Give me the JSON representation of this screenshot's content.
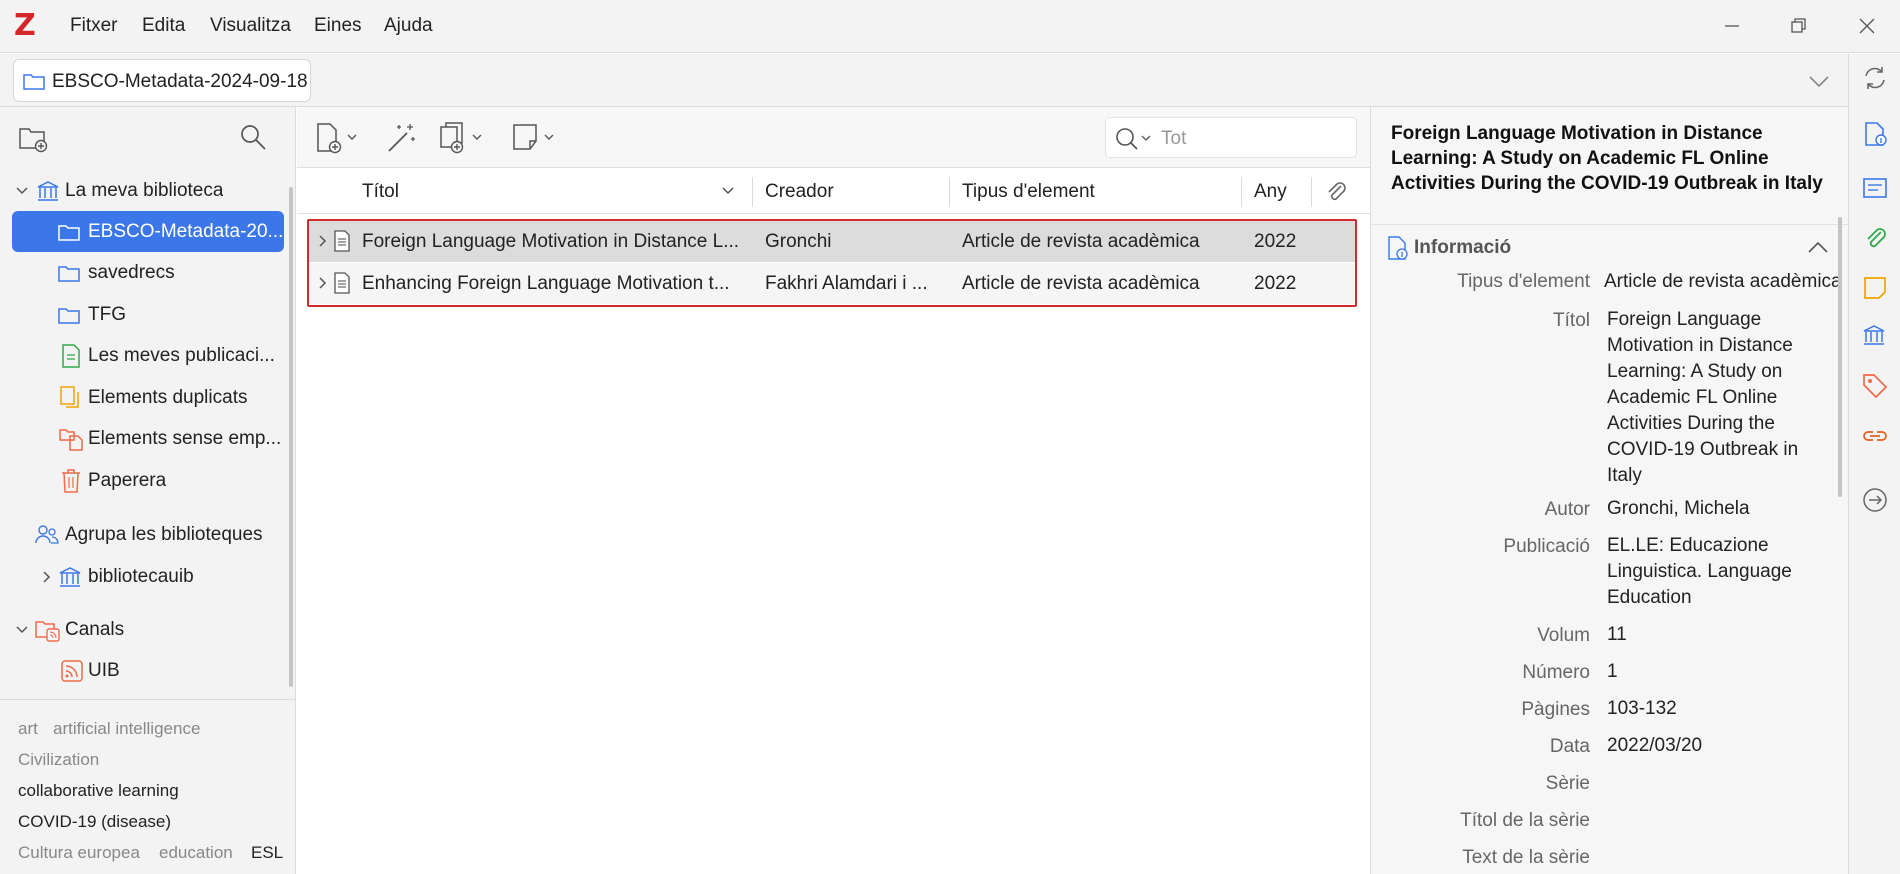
{
  "app": {
    "logo": "Z"
  },
  "menu": [
    "Fitxer",
    "Edita",
    "Visualitza",
    "Eines",
    "Ajuda"
  ],
  "tab": {
    "label": "EBSCO-Metadata-2024-09-18"
  },
  "library": {
    "items": [
      {
        "label": "La meva biblioteca"
      },
      {
        "label": "EBSCO-Metadata-20..."
      },
      {
        "label": "savedrecs"
      },
      {
        "label": "TFG"
      },
      {
        "label": "Les meves publicaci..."
      },
      {
        "label": "Elements duplicats"
      },
      {
        "label": "Elements sense emp..."
      },
      {
        "label": "Paperera"
      },
      {
        "label": "Agrupa les biblioteques"
      },
      {
        "label": "bibliotecauib"
      },
      {
        "label": "Canals"
      },
      {
        "label": "UIB"
      }
    ]
  },
  "tags": [
    "art",
    "artificial intelligence",
    "Civilization",
    "collaborative learning",
    "COVID-19 (disease)",
    "Cultura europea",
    "education",
    "ESL"
  ],
  "search": {
    "placeholder": "Tot"
  },
  "columns": {
    "title": "Títol",
    "creator": "Creador",
    "type": "Tipus d'element",
    "year": "Any"
  },
  "rows": [
    {
      "title": "Foreign Language Motivation in Distance L...",
      "creator": "Gronchi",
      "type": "Article de revista acadèmica",
      "year": "2022"
    },
    {
      "title": "Enhancing Foreign Language Motivation t...",
      "creator": "Fakhri Alamdari i ...",
      "type": "Article de revista acadèmica",
      "year": "2022"
    }
  ],
  "item": {
    "title": "Foreign Language Motivation in Distance Learning: A Study on Academic FL Online Activities During the COVID-19 Outbreak in Italy",
    "section": "Informació",
    "fields": [
      {
        "label": "Tipus d'element",
        "value": "Article de revista acadèmica"
      },
      {
        "label": "Títol",
        "value": "Foreign Language Motivation in Distance Learning: A Study on Academic FL Online Activities During the COVID-19 Outbreak in Italy"
      },
      {
        "label": "Autor",
        "value": "Gronchi, Michela"
      },
      {
        "label": "Publicació",
        "value": "EL.LE: Educazione Linguistica. Language Education"
      },
      {
        "label": "Volum",
        "value": "11"
      },
      {
        "label": "Número",
        "value": "1"
      },
      {
        "label": "Pàgines",
        "value": "103-132"
      },
      {
        "label": "Data",
        "value": "2022/03/20"
      },
      {
        "label": "Sèrie",
        "value": ""
      },
      {
        "label": "Títol de la sèrie",
        "value": ""
      },
      {
        "label": "Text de la sèrie",
        "value": ""
      }
    ]
  },
  "colors": {
    "accent": "#3b77e8",
    "highlight": "#d32a2f",
    "logo": "#d4262b"
  }
}
